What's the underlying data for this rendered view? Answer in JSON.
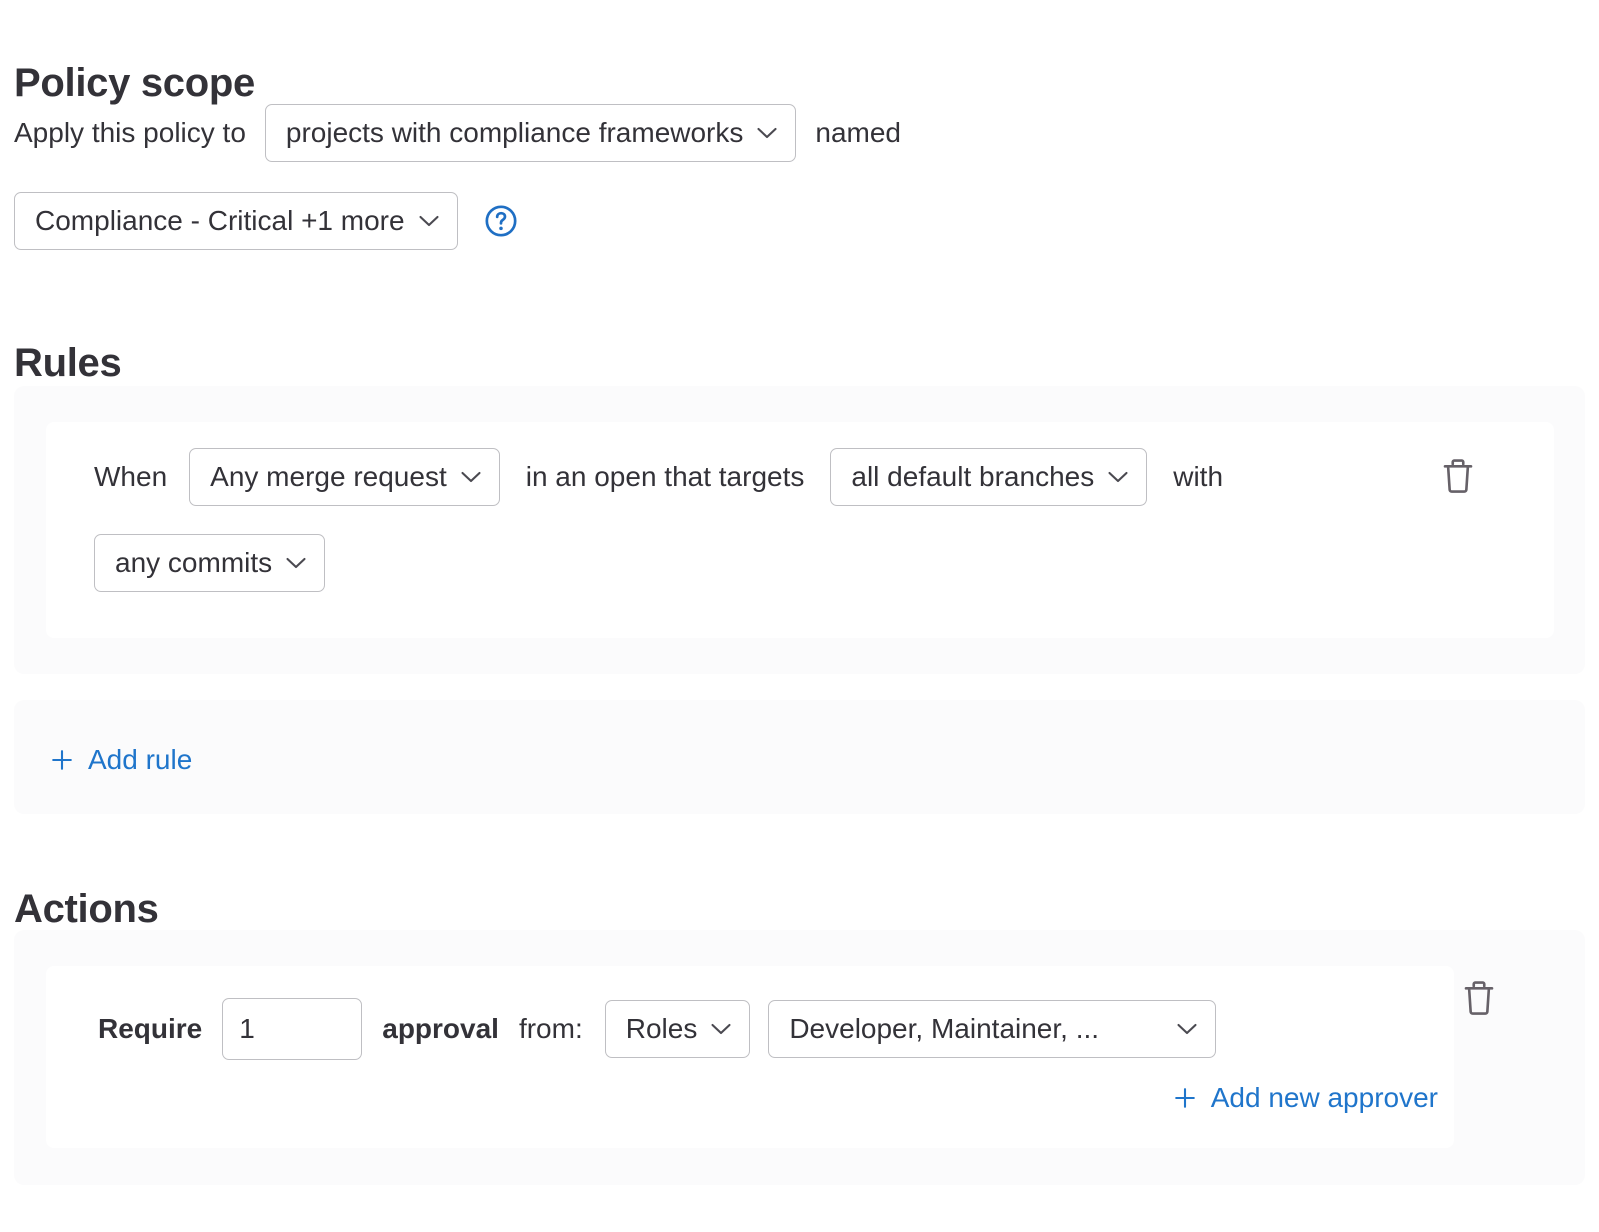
{
  "policy_scope": {
    "heading": "Policy scope",
    "apply_label": "Apply this policy to",
    "scope_type_dropdown": "projects with compliance frameworks",
    "named_label": "named",
    "framework_dropdown": "Compliance - Critical +1 more",
    "help_icon": "help-circle-icon"
  },
  "rules": {
    "heading": "Rules",
    "rule": {
      "when_label": "When",
      "merge_request_dropdown": "Any merge request",
      "middle_label": "in an open that targets",
      "branches_dropdown": "all default branches",
      "with_label": "with",
      "commits_dropdown": "any commits",
      "delete_icon": "trash-icon"
    },
    "add_rule_label": "Add rule",
    "add_rule_icon": "plus-icon"
  },
  "actions": {
    "heading": "Actions",
    "action": {
      "require_label": "Require",
      "approvals_count": "1",
      "approval_label": "approval",
      "from_label": "from:",
      "approver_type_dropdown": "Roles",
      "roles_dropdown": "Developer, Maintainer, ...",
      "add_approver_label": "Add new approver",
      "add_approver_icon": "plus-icon",
      "delete_icon": "trash-icon"
    }
  },
  "colors": {
    "heading_text": "#333238",
    "body_text": "#333238",
    "link_blue": "#1f75cb",
    "panel_bg": "#fbfbfc",
    "card_bg": "#ffffff",
    "border_gray": "#bfbfc3",
    "icon_gray": "#666168"
  }
}
